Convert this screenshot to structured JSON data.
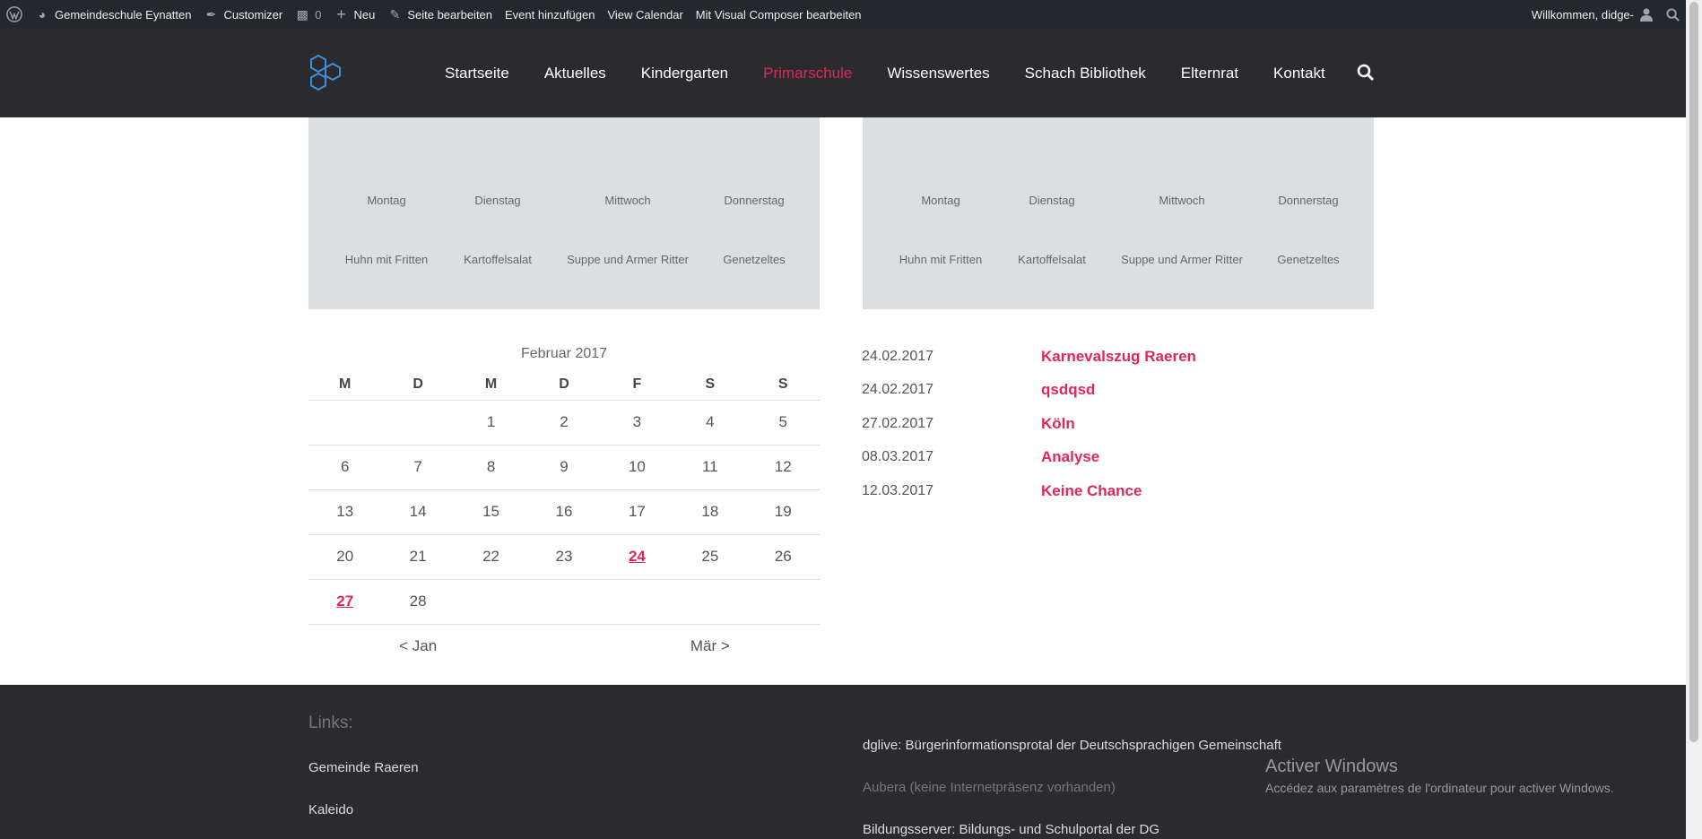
{
  "adminbar": {
    "site_name": "Gemeindeschule Eynatten",
    "customizer": "Customizer",
    "comments_count": "0",
    "new_label": "Neu",
    "edit_page": "Seite bearbeiten",
    "add_event": "Event hinzufügen",
    "view_calendar": "View Calendar",
    "visual_composer": "Mit Visual Composer bearbeiten",
    "welcome": "Willkommen, didge-"
  },
  "nav": {
    "items": [
      {
        "label": "Startseite"
      },
      {
        "label": "Aktuelles"
      },
      {
        "label": "Kindergarten"
      },
      {
        "label": "Primarschule",
        "active": true
      },
      {
        "label": "Wissenswertes"
      },
      {
        "label": "Schach Bibliothek"
      },
      {
        "label": "Elternrat"
      },
      {
        "label": "Kontakt"
      }
    ]
  },
  "menu_left": {
    "days": [
      "Montag",
      "Dienstag",
      "Mittwoch",
      "Donnerstag"
    ],
    "dishes": [
      "Huhn mit Fritten",
      "Kartoffelsalat",
      "Suppe und Armer Ritter",
      "Genetzeltes"
    ]
  },
  "menu_right": {
    "days": [
      "Montag",
      "Dienstag",
      "Mittwoch",
      "Donnerstag"
    ],
    "dishes": [
      "Huhn mit Fritten",
      "Kartoffelsalat",
      "Suppe und Armer Ritter",
      "Genetzeltes"
    ]
  },
  "calendar": {
    "caption": "Februar 2017",
    "weekdays": [
      "M",
      "D",
      "M",
      "D",
      "F",
      "S",
      "S"
    ],
    "weeks": [
      [
        "",
        "",
        "1",
        "2",
        "3",
        "4",
        "5"
      ],
      [
        "6",
        "7",
        "8",
        "9",
        "10",
        "11",
        "12"
      ],
      [
        "13",
        "14",
        "15",
        "16",
        "17",
        "18",
        "19"
      ],
      [
        "20",
        "21",
        "22",
        "23",
        "24",
        "25",
        "26"
      ],
      [
        "27",
        "28",
        "",
        "",
        "",
        "",
        ""
      ]
    ],
    "event_days": [
      "24",
      "27"
    ],
    "prev": "< Jan",
    "next": "Mär >"
  },
  "events": [
    {
      "date": "24.02.2017",
      "title": "Karnevalszug Raeren"
    },
    {
      "date": "24.02.2017",
      "title": "qsdqsd"
    },
    {
      "date": "27.02.2017",
      "title": "Köln"
    },
    {
      "date": "08.03.2017",
      "title": "Analyse"
    },
    {
      "date": "12.03.2017",
      "title": "Keine Chance"
    }
  ],
  "footer": {
    "links_title": "Links:",
    "link_raeren": "Gemeinde Raeren",
    "link_kaleido": "Kaleido",
    "link_dglive": "dglive: Bürgerinformationsprotal der Deutschsprachigen Gemeinschaft",
    "link_aubera": "Aubera (keine Internetpräsenz vorhanden)",
    "link_bildung": "Bildungsserver: Bildungs- und Schulportal der DG"
  },
  "watermark": {
    "line1": "Activer Windows",
    "line2": "Accédez aux paramètres de l'ordinateur pour activer Windows."
  }
}
